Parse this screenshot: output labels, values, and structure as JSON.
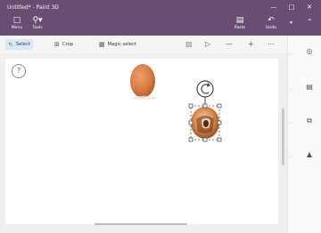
{
  "window": {
    "title": "Untitled* - Paint 3D"
  },
  "ribbon": {
    "menu_label": "Menu",
    "tools_label": "Tools",
    "paste_label": "Paste",
    "undo_label": "Undo"
  },
  "toolbar": {
    "select_label": "Select",
    "crop_label": "Crop",
    "magic_select_label": "Magic select"
  },
  "canvas": {
    "help_label": "?"
  },
  "icons": {
    "menu": "menu-icon",
    "tools": "tools-icon",
    "paste": "paste-icon",
    "undo": "undo-icon",
    "select": "select-cursor-icon",
    "crop": "crop-icon",
    "magic_select": "magic-select-icon",
    "rotate": "rotate-icon"
  },
  "colors": {
    "titlebar": "#6a4d72",
    "active_tool": "#dde6f2",
    "selection": "#555555"
  }
}
